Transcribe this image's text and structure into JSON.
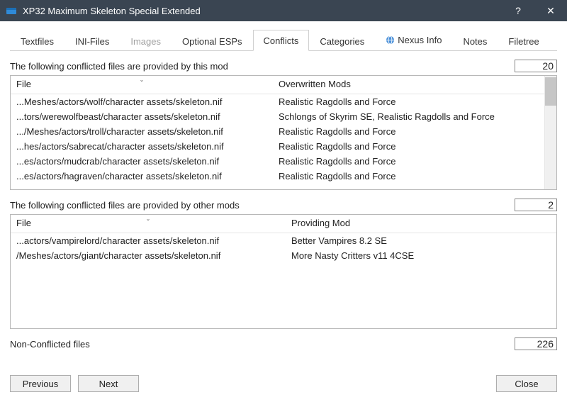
{
  "window": {
    "title": "XP32 Maximum Skeleton Special Extended",
    "help": "?",
    "close": "✕"
  },
  "tabs": [
    {
      "label": "Textfiles",
      "active": false,
      "disabled": false
    },
    {
      "label": "INI-Files",
      "active": false,
      "disabled": false
    },
    {
      "label": "Images",
      "active": false,
      "disabled": true
    },
    {
      "label": "Optional ESPs",
      "active": false,
      "disabled": false
    },
    {
      "label": "Conflicts",
      "active": true,
      "disabled": false
    },
    {
      "label": "Categories",
      "active": false,
      "disabled": false
    },
    {
      "label": "Nexus Info",
      "active": false,
      "disabled": false,
      "icon": "globe"
    },
    {
      "label": "Notes",
      "active": false,
      "disabled": false
    },
    {
      "label": "Filetree",
      "active": false,
      "disabled": false
    }
  ],
  "section1": {
    "label": "The following conflicted files are provided by this mod",
    "count": "20",
    "col1": "File",
    "col2": "Overwritten Mods",
    "rows": [
      {
        "file": "...Meshes/actors/wolf/character assets/skeleton.nif",
        "mods": "Realistic Ragdolls and Force"
      },
      {
        "file": "...tors/werewolfbeast/character assets/skeleton.nif",
        "mods": "Schlongs of Skyrim SE, Realistic Ragdolls and Force"
      },
      {
        "file": ".../Meshes/actors/troll/character assets/skeleton.nif",
        "mods": "Realistic Ragdolls and Force"
      },
      {
        "file": "...hes/actors/sabrecat/character assets/skeleton.nif",
        "mods": "Realistic Ragdolls and Force"
      },
      {
        "file": "...es/actors/mudcrab/character assets/skeleton.nif",
        "mods": "Realistic Ragdolls and Force"
      },
      {
        "file": "...es/actors/hagraven/character assets/skeleton.nif",
        "mods": "Realistic Ragdolls and Force"
      }
    ]
  },
  "section2": {
    "label": "The following conflicted files are provided by other mods",
    "count": "2",
    "col1": "File",
    "col2": "Providing Mod",
    "rows": [
      {
        "file": "...actors/vampirelord/character assets/skeleton.nif",
        "mod": "Better Vampires 8.2 SE"
      },
      {
        "file": "/Meshes/actors/giant/character assets/skeleton.nif",
        "mod": "More Nasty Critters v11 4CSE"
      }
    ]
  },
  "nonConflicted": {
    "label": "Non-Conflicted files",
    "count": "226"
  },
  "buttons": {
    "previous": "Previous",
    "next": "Next",
    "close": "Close"
  }
}
